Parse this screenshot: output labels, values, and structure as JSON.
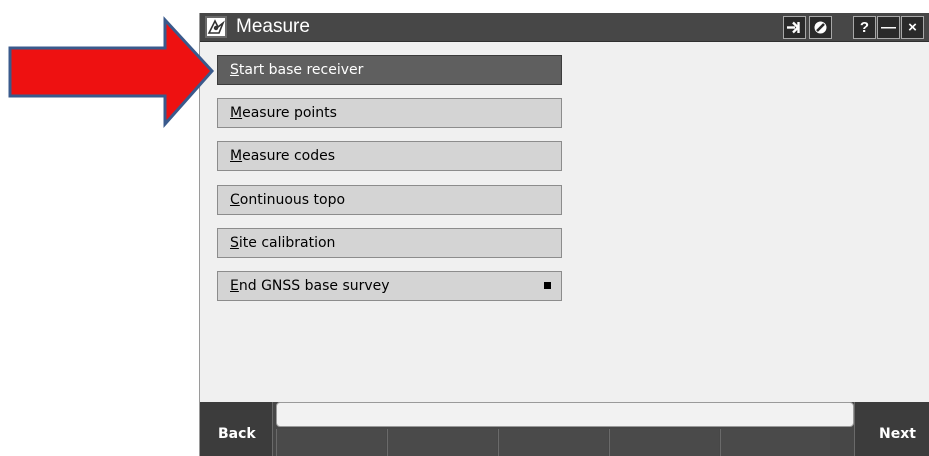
{
  "window": {
    "title": "Measure"
  },
  "menu": {
    "items": [
      {
        "first": "S",
        "rest": "tart base receiver"
      },
      {
        "first": "M",
        "rest": "easure points"
      },
      {
        "first": "M",
        "rest": "easure codes"
      },
      {
        "first": "C",
        "rest": "ontinuous topo"
      },
      {
        "first": "S",
        "rest": "ite calibration"
      },
      {
        "first": "E",
        "rest": "nd GNSS base survey"
      }
    ],
    "selected_index": 0
  },
  "titlebar": {
    "help_label": "?",
    "minimize_label": "—",
    "close_label": "×"
  },
  "bottombar": {
    "back_label": "Back",
    "next_label": "Next"
  },
  "colors": {
    "titlebar_bg": "#474747",
    "selected_item_bg": "#5f5f5f",
    "item_bg": "#d4d4d4",
    "arrow_fill": "#ee1111",
    "arrow_outline": "#3a5a8c"
  }
}
